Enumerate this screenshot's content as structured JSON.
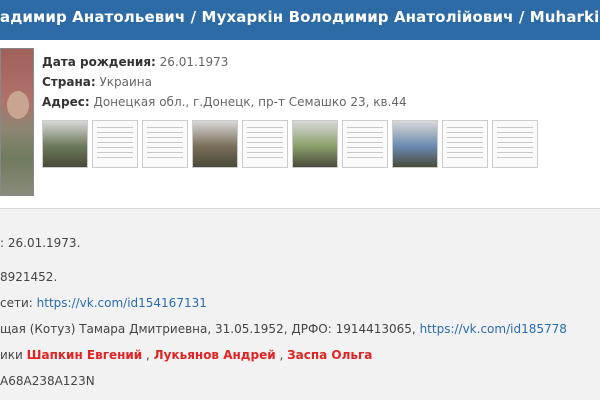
{
  "header": {
    "title": "адимир Анатольевич / Мухаркін Володимир Анатолійович / Muharkin V"
  },
  "profile": {
    "birth_label": "Дата рождения:",
    "birth_value": "26.01.1973",
    "country_label": "Страна:",
    "country_value": "Украина",
    "address_label": "Адрес:",
    "address_value": "Донецкая обл., г.Донецк, пр-т Семашко 23, кв.44"
  },
  "thumbnails": [
    {
      "kind": "photo",
      "color": "#6b7a5a"
    },
    {
      "kind": "document"
    },
    {
      "kind": "document"
    },
    {
      "kind": "photo",
      "color": "#7a6e5a"
    },
    {
      "kind": "document"
    },
    {
      "kind": "photo",
      "color": "#8aa06a"
    },
    {
      "kind": "document"
    },
    {
      "kind": "photo",
      "color": "#6a8ab0"
    },
    {
      "kind": "document"
    },
    {
      "kind": "document"
    }
  ],
  "details": {
    "dob": ": 26.01.1973.",
    "id_fragment": "8921452.",
    "social_label": "сети: ",
    "social_link": "https://vk.com/id154167131",
    "relative_text": "щая (Котуз) Тамара Дмитриевна, 31.05.1952, ДРФО: 1914413065, ",
    "relative_link": "https://vk.com/id185778",
    "colleagues_label": "ики ",
    "colleague_1": "Шапкин Евгений",
    "colleague_2": "Лукьянов Андрей",
    "colleague_3": "Заспа Ольга",
    "separator": " , ",
    "code": "A68A238A123N"
  }
}
